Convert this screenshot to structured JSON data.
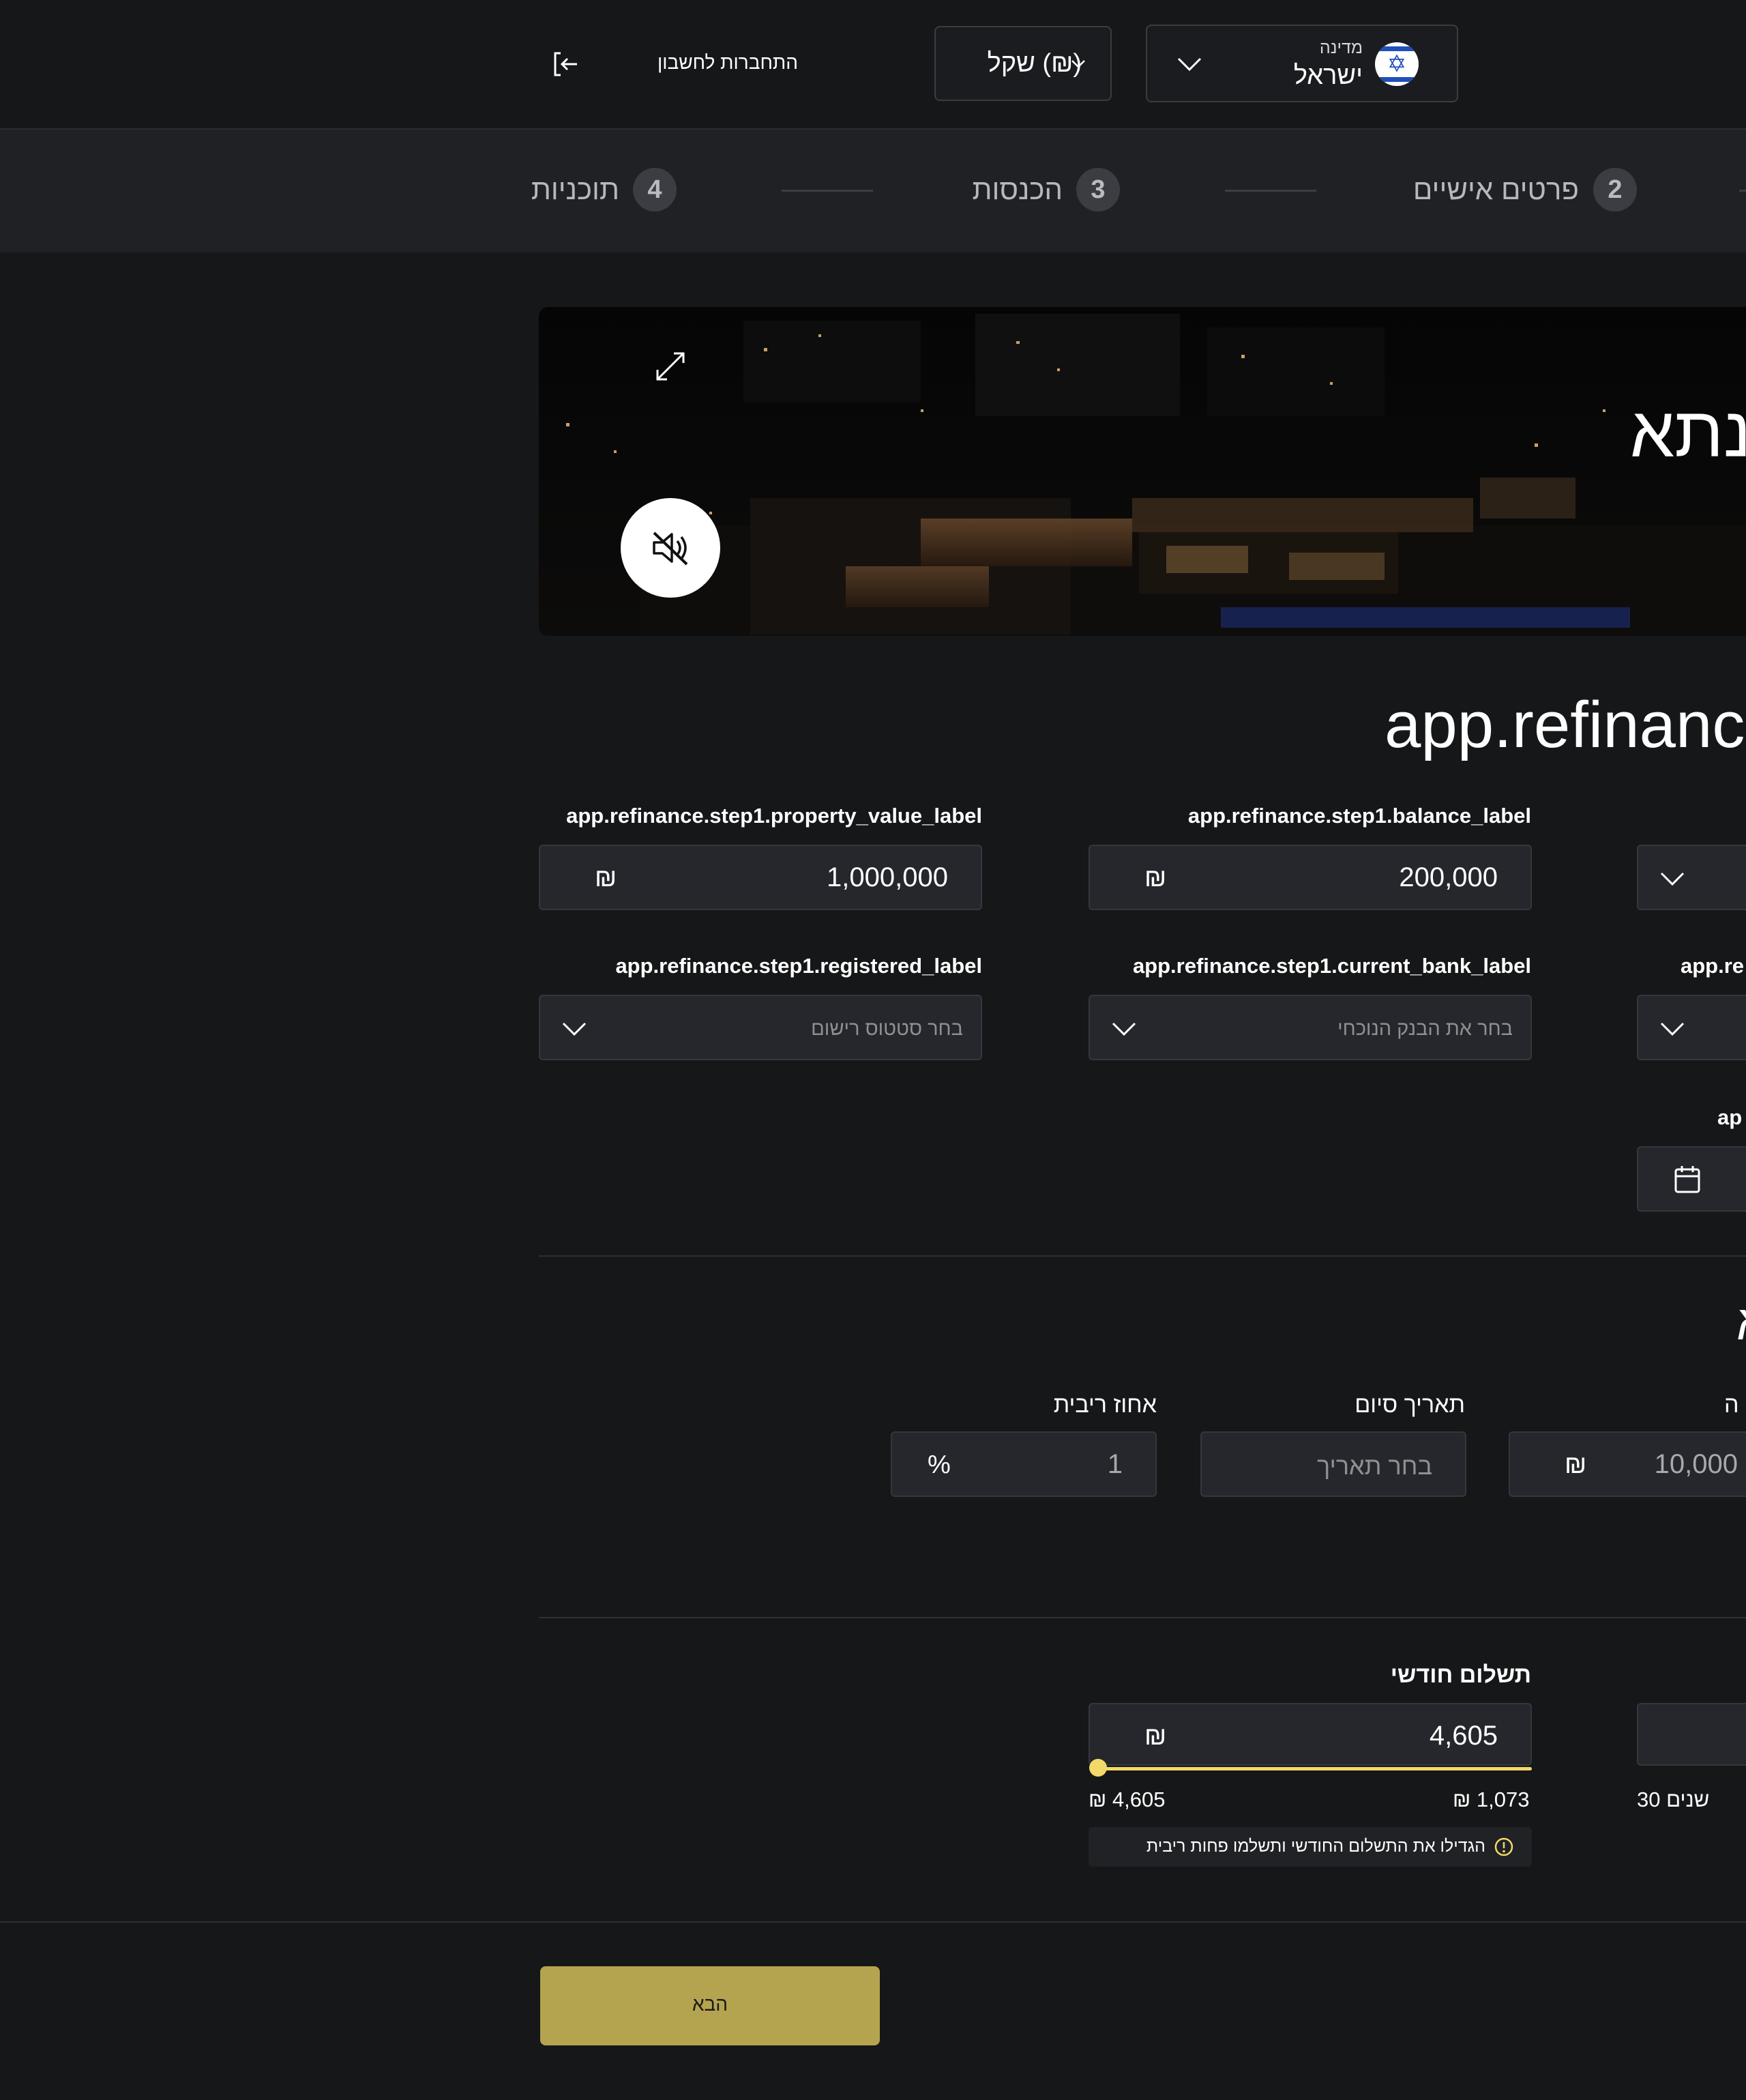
{
  "header": {
    "country_label": "מדינה",
    "country_value": "ישראל",
    "currency_value": "שקל (₪)",
    "login_label": "התחברות לחשבון"
  },
  "steps": [
    {
      "num": "2",
      "label": "פרטים אישיים"
    },
    {
      "num": "3",
      "label": "הכנסות"
    },
    {
      "num": "4",
      "label": "תוכניות"
    }
  ],
  "hero": {
    "title": "בנתא"
  },
  "form": {
    "title": "app.refinanc",
    "property_value": {
      "label": "app.refinance.step1.property_value_label",
      "value": "1,000,000",
      "currency": "₪"
    },
    "balance": {
      "label": "app.refinance.step1.balance_label",
      "value": "200,000",
      "currency": "₪"
    },
    "registered": {
      "label": "app.refinance.step1.registered_label",
      "placeholder": "בחר סטטוס רישום"
    },
    "current_bank": {
      "label": "app.refinance.step1.current_bank_label",
      "placeholder": "בחר את הבנק הנוכחי"
    },
    "partial_label_right": "app.re",
    "partial_label_date": "ap",
    "section2_partial_title": "א",
    "interest_rate": {
      "label": "אחוז ריבית",
      "value": "1",
      "unit": "%"
    },
    "end_date": {
      "label": "תאריך סיום",
      "placeholder": "בחר תאריך"
    },
    "amount": {
      "label_partial": "ה",
      "value": "10,000",
      "currency": "₪"
    },
    "monthly_payment": {
      "label": "תשלום חודשי",
      "value": "4,605",
      "currency": "₪",
      "min": "₪ 1,073",
      "max": "₪ 4,605",
      "slider_fraction": 1.0,
      "hint": "הגדילו את התשלום החודשי ותשלמו פחות ריבית"
    },
    "years_label": "30 שנים"
  },
  "footer": {
    "next_label": "הבא"
  },
  "colors": {
    "background": "#161718",
    "panel": "#1f2125",
    "input_bg": "#25272c",
    "accent_yellow": "#f3d96a",
    "next_button": "#b5a44f"
  }
}
